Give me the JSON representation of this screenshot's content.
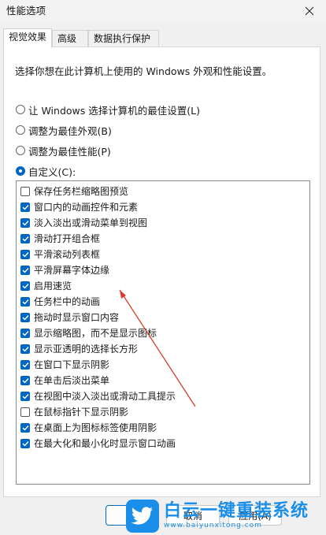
{
  "window": {
    "title": "性能选项"
  },
  "tabs": [
    {
      "label": "视觉效果",
      "active": true
    },
    {
      "label": "高级",
      "active": false
    },
    {
      "label": "数据执行保护",
      "active": false
    }
  ],
  "panel": {
    "description": "选择你想在此计算机上使用的 Windows 外观和性能设置。",
    "radios": [
      {
        "label": "让 Windows 选择计算机的最佳设置(L)",
        "checked": false
      },
      {
        "label": "调整为最佳外观(B)",
        "checked": false
      },
      {
        "label": "调整为最佳性能(P)",
        "checked": false
      },
      {
        "label": "自定义(C):",
        "checked": true
      }
    ],
    "options": [
      {
        "label": "保存任务栏缩略图预览",
        "checked": false
      },
      {
        "label": "窗口内的动画控件和元素",
        "checked": true
      },
      {
        "label": "淡入淡出或滑动菜单到视图",
        "checked": true
      },
      {
        "label": "滑动打开组合框",
        "checked": true
      },
      {
        "label": "平滑滚动列表框",
        "checked": true
      },
      {
        "label": "平滑屏幕字体边缘",
        "checked": true
      },
      {
        "label": "启用速览",
        "checked": true
      },
      {
        "label": "任务栏中的动画",
        "checked": true
      },
      {
        "label": "拖动时显示窗口内容",
        "checked": true
      },
      {
        "label": "显示缩略图，而不是显示图标",
        "checked": true
      },
      {
        "label": "显示亚透明的选择长方形",
        "checked": true
      },
      {
        "label": "在窗口下显示阴影",
        "checked": true
      },
      {
        "label": "在单击后淡出菜单",
        "checked": true
      },
      {
        "label": "在视图中淡入淡出或滑动工具提示",
        "checked": true
      },
      {
        "label": "在鼠标指针下显示阴影",
        "checked": false
      },
      {
        "label": "在桌面上为图标标签使用阴影",
        "checked": true
      },
      {
        "label": "在最大化和最小化时显示窗口动画",
        "checked": true
      }
    ]
  },
  "buttons": {
    "ok": "",
    "cancel": "取消",
    "apply": "应用(A)"
  },
  "watermark": {
    "title": "白云一键重装系统",
    "url": "www.baiyunxitong.com"
  },
  "colors": {
    "accent": "#0067c0",
    "arrow": "#d83b2b",
    "watermark": "#1a8ee8"
  }
}
